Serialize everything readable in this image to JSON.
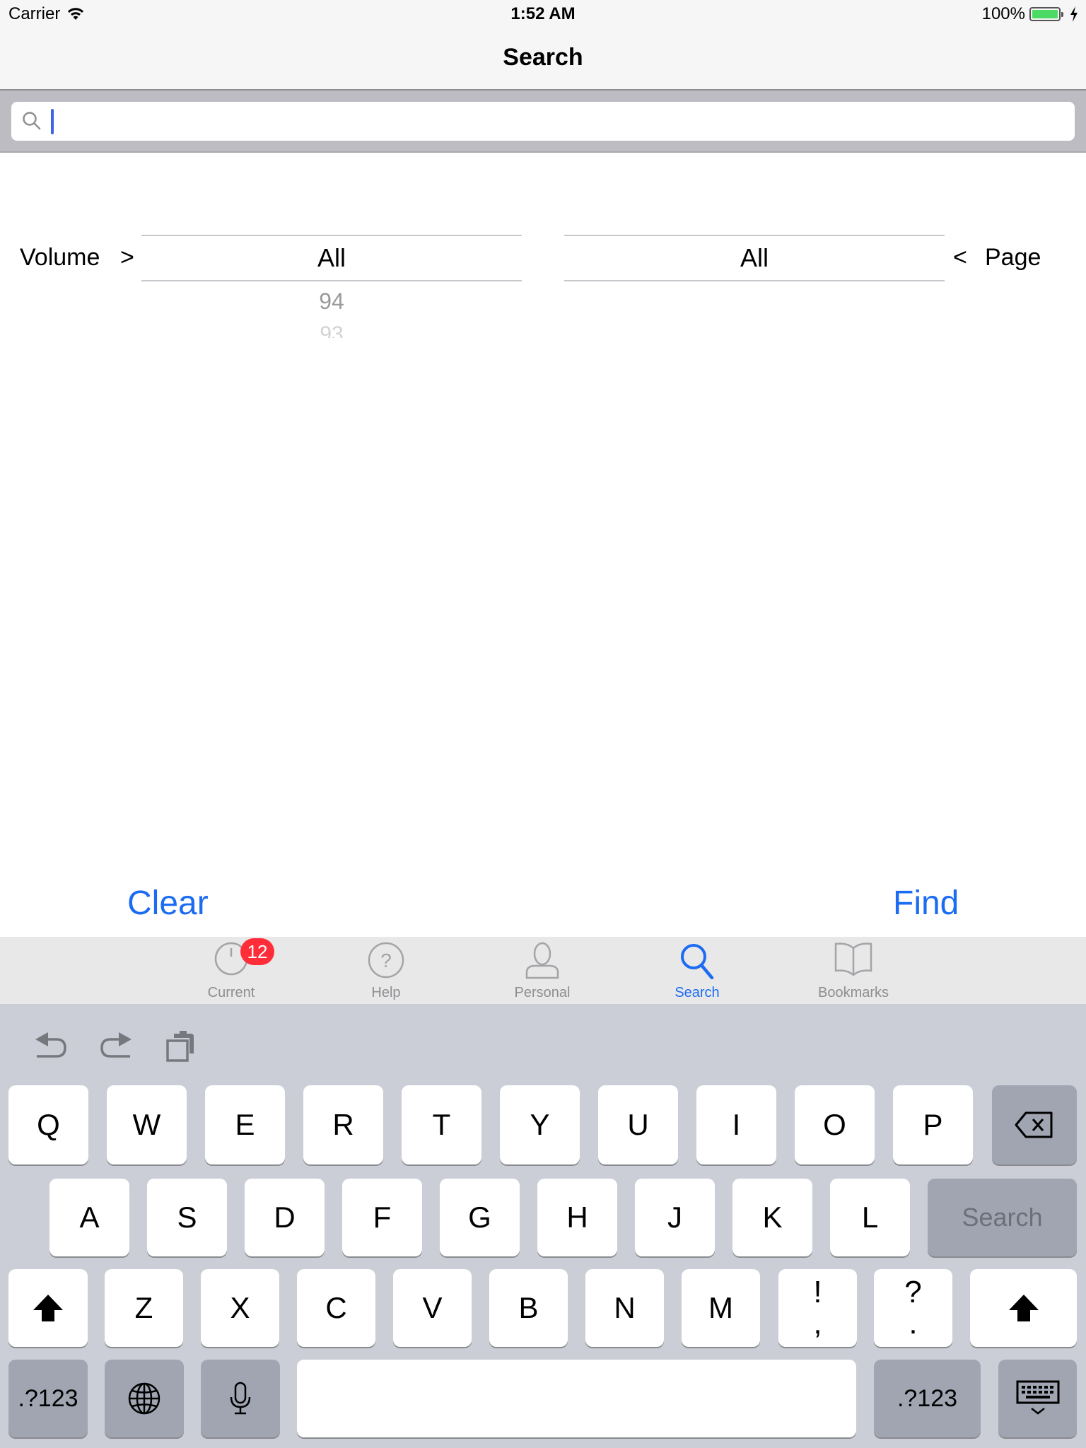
{
  "status_bar": {
    "carrier": "Carrier",
    "time": "1:52 AM",
    "battery_percent": "100%",
    "battery_level": 1.0
  },
  "nav": {
    "title": "Search"
  },
  "search": {
    "value": "",
    "placeholder": ""
  },
  "volume_picker": {
    "label": "Volume",
    "arrow": ">",
    "selected": "All",
    "options_below": [
      "94",
      "93"
    ]
  },
  "page_picker": {
    "label": "Page",
    "arrow": "<",
    "selected": "All"
  },
  "actions": {
    "clear": "Clear",
    "find": "Find"
  },
  "colors": {
    "accent": "#1b6cf2",
    "badge": "#ff2d38",
    "battery": "#4cd964"
  },
  "tabbar": {
    "tabs": [
      {
        "label": "Current",
        "icon": "clock-icon",
        "badge": "12"
      },
      {
        "label": "Help",
        "icon": "question-circle-icon"
      },
      {
        "label": "Personal",
        "icon": "person-icon"
      },
      {
        "label": "Search",
        "icon": "search-icon",
        "active": true
      },
      {
        "label": "Bookmarks",
        "icon": "book-icon"
      }
    ]
  },
  "keyboard": {
    "toolbar": [
      "undo-icon",
      "redo-icon",
      "paste-icon"
    ],
    "row1": [
      "Q",
      "W",
      "E",
      "R",
      "T",
      "Y",
      "U",
      "I",
      "O",
      "P"
    ],
    "row2": [
      "A",
      "S",
      "D",
      "F",
      "G",
      "H",
      "J",
      "K",
      "L"
    ],
    "row3": [
      "Z",
      "X",
      "C",
      "V",
      "B",
      "N",
      "M"
    ],
    "punct1": {
      "top": "!",
      "bottom": ","
    },
    "punct2": {
      "top": "?",
      "bottom": "."
    },
    "search_key": "Search",
    "numbers_key": ".?123"
  }
}
